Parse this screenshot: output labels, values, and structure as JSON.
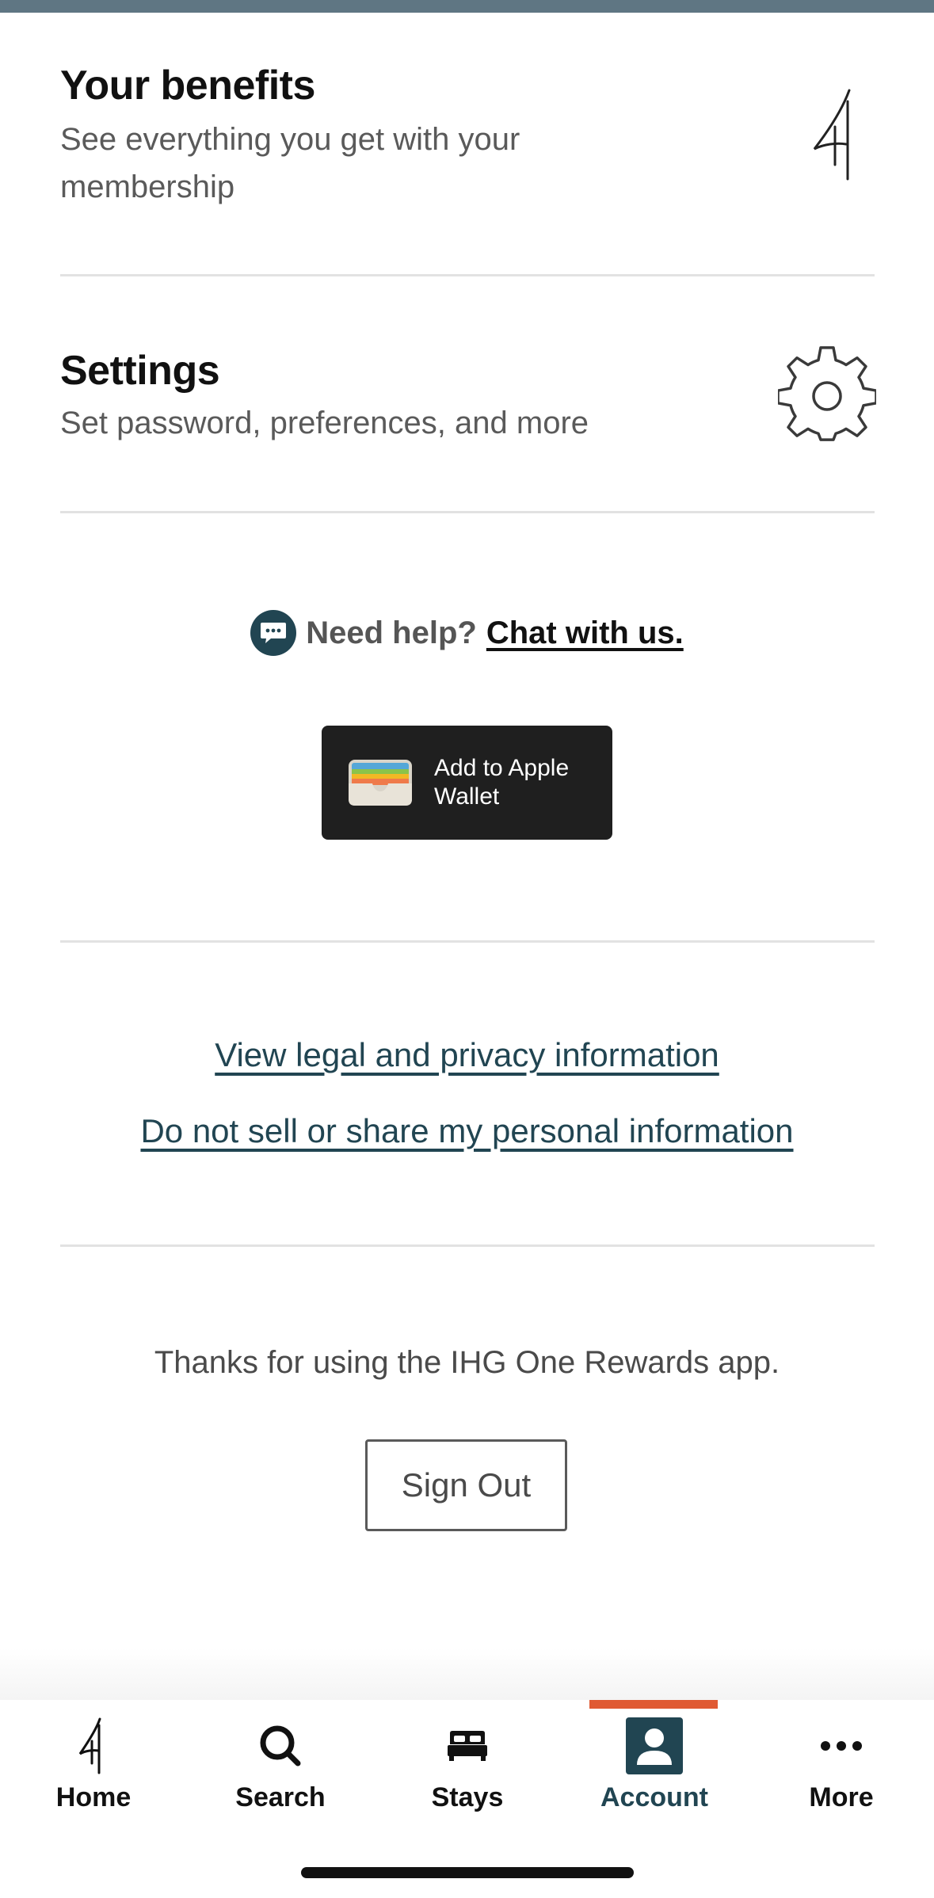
{
  "benefits": {
    "title": "Your benefits",
    "subtitle_line1": "See everything you get with your",
    "subtitle_line2": "membership",
    "icon": "ihg-logo-icon"
  },
  "settings": {
    "title": "Settings",
    "subtitle": "Set password, preferences, and more",
    "icon": "gear-icon"
  },
  "help": {
    "prefix": "Need help?",
    "link": "Chat with us.",
    "icon": "chat-bubble-icon"
  },
  "wallet": {
    "label_line1": "Add to Apple",
    "label_line2": "Wallet",
    "icon": "wallet-icon"
  },
  "legal": {
    "privacy_link": "View legal and privacy information",
    "do_not_sell_link": "Do not sell or share my personal information"
  },
  "footer": {
    "thanks": "Thanks for using the IHG One Rewards app.",
    "sign_out": "Sign Out"
  },
  "tabs": [
    {
      "label": "Home",
      "icon": "ihg-logo-icon",
      "active": false
    },
    {
      "label": "Search",
      "icon": "search-icon",
      "active": false
    },
    {
      "label": "Stays",
      "icon": "bed-icon",
      "active": false
    },
    {
      "label": "Account",
      "icon": "person-icon",
      "active": true
    },
    {
      "label": "More",
      "icon": "ellipsis-icon",
      "active": false
    }
  ],
  "colors": {
    "accent": "#214552",
    "active_indicator": "#e05a33",
    "top_strip": "#5f7683"
  }
}
